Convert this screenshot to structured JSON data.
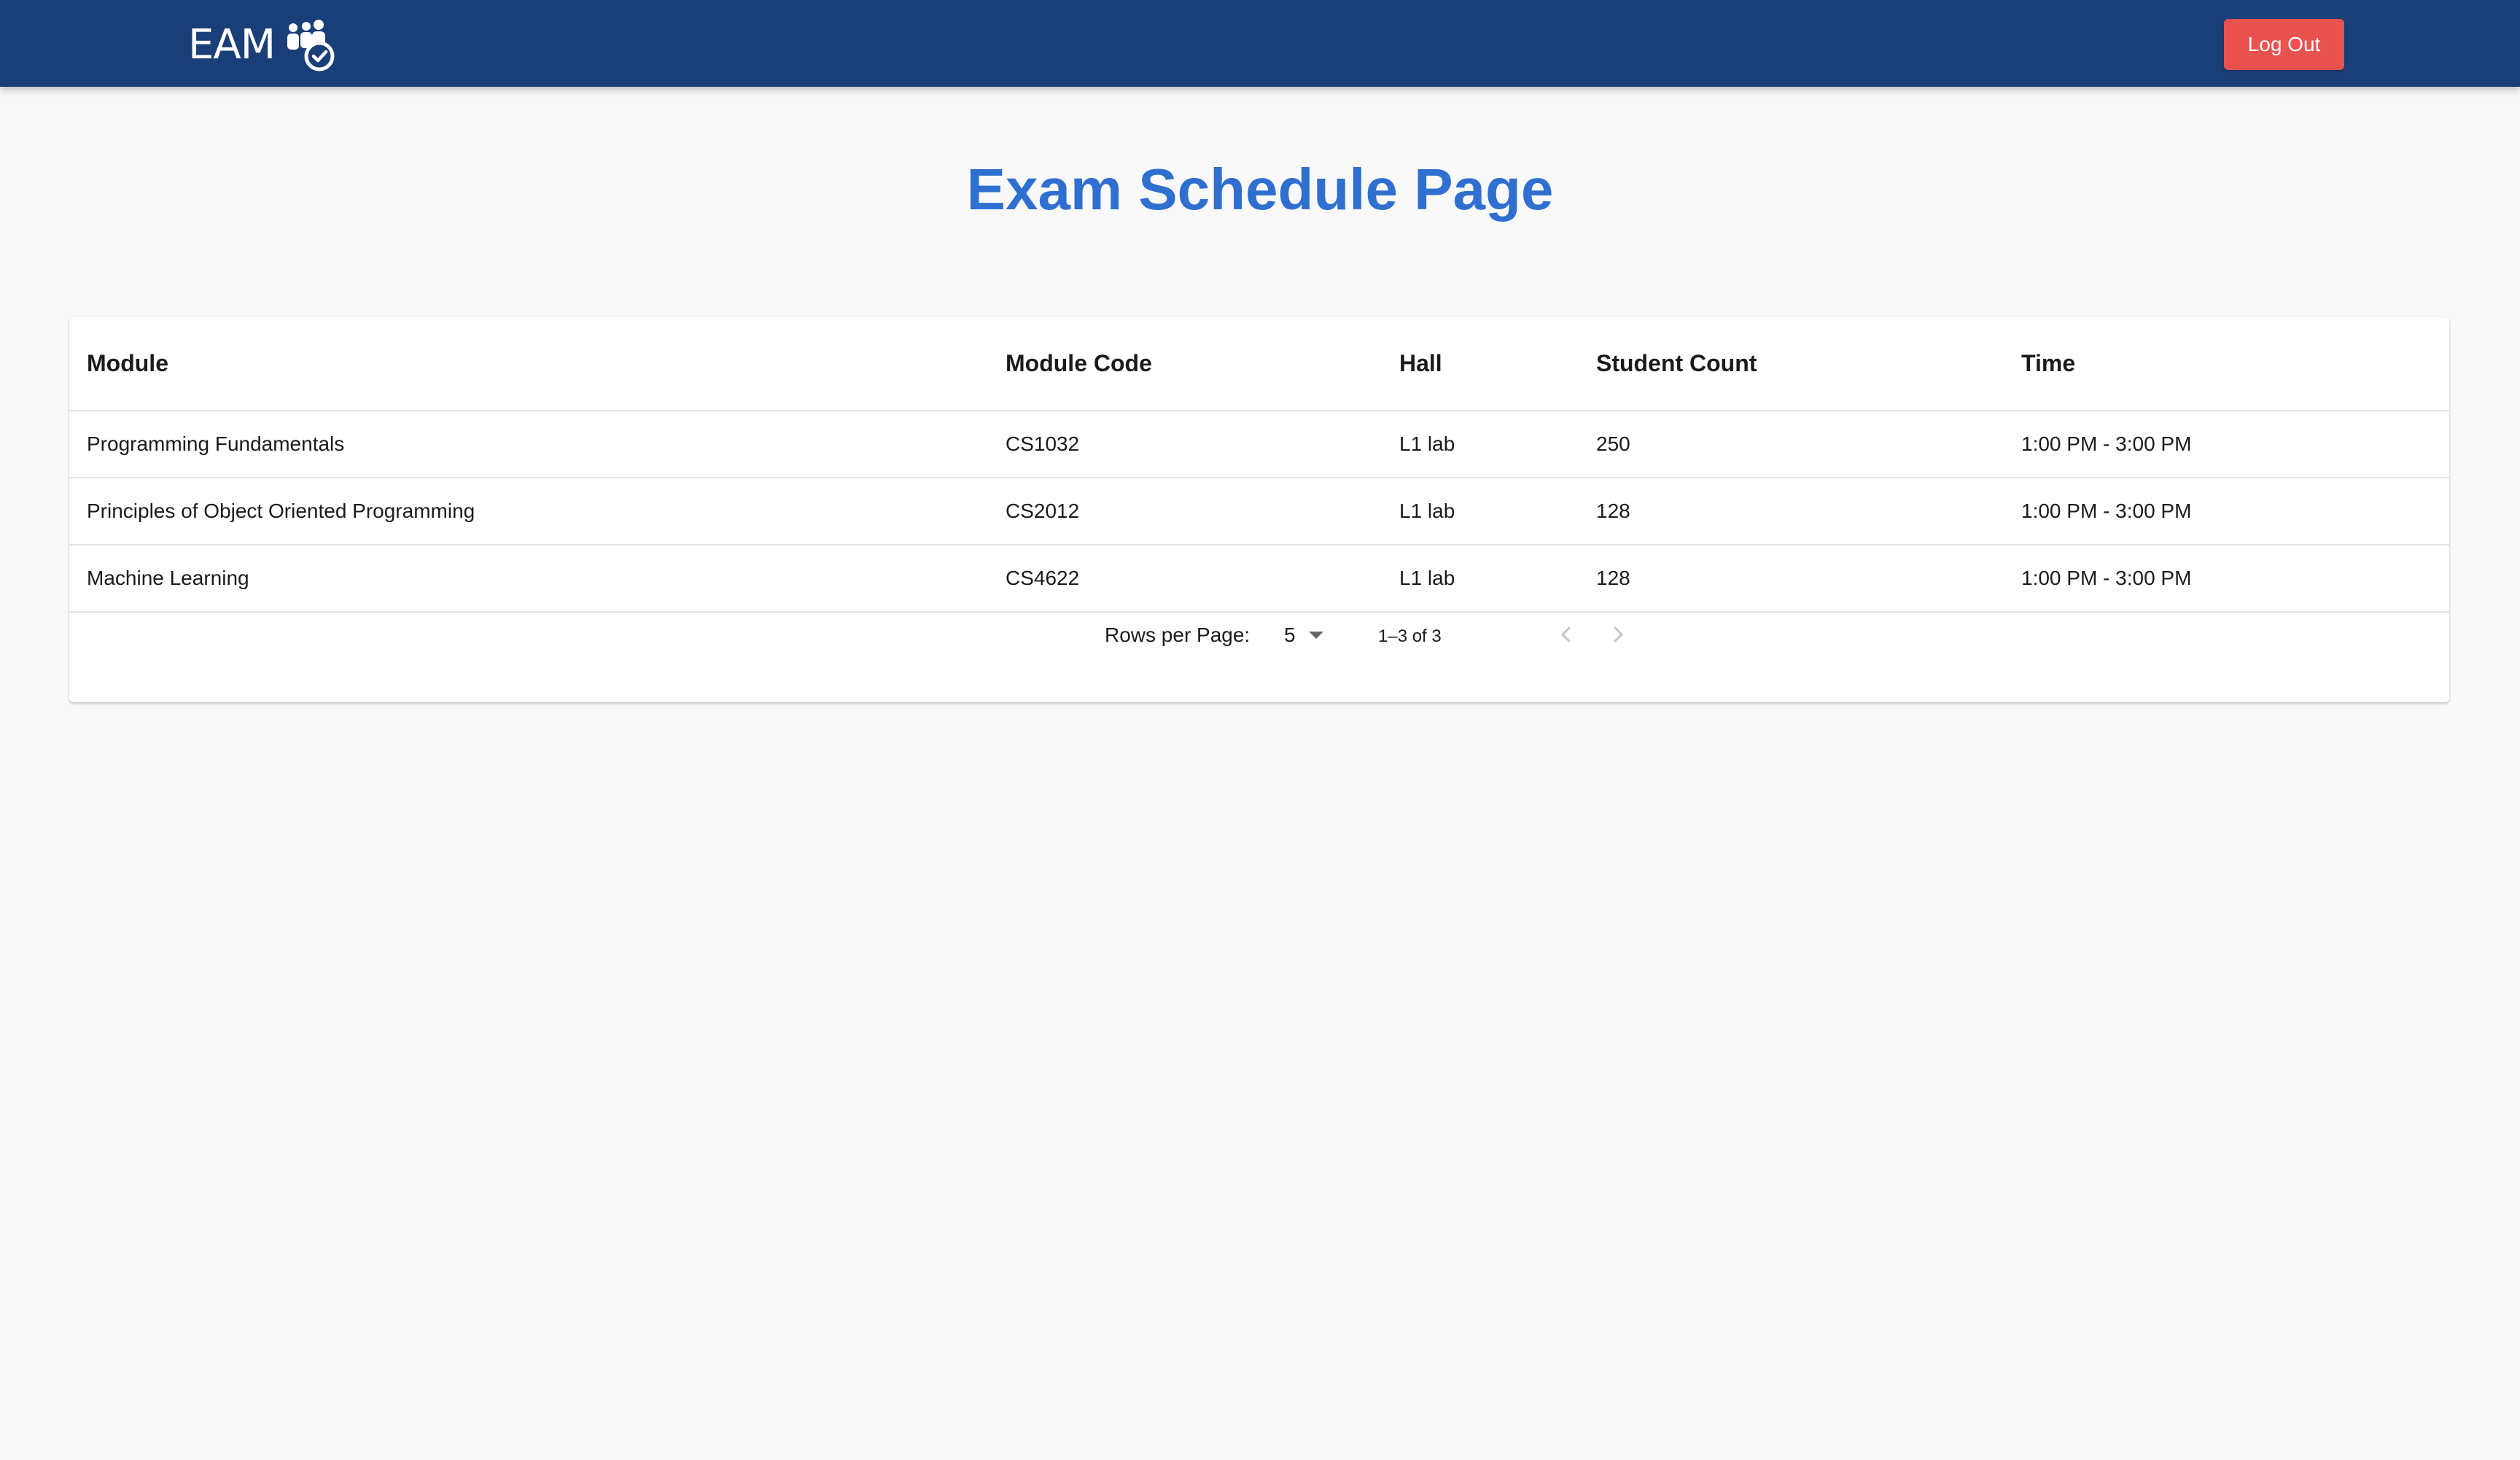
{
  "header": {
    "logo_text": "EAM",
    "logout_label": "Log Out",
    "background_color": "#1a3f78",
    "logout_color": "#e8524f"
  },
  "page": {
    "title": "Exam Schedule Page",
    "title_color": "#2f6fd0"
  },
  "table": {
    "columns": [
      "Module",
      "Module Code",
      "Hall",
      "Student Count",
      "Time"
    ],
    "rows": [
      [
        "Programming Fundamentals",
        "CS1032",
        "L1 lab",
        "250",
        "1:00 PM - 3:00 PM"
      ],
      [
        "Principles of Object Oriented Programming",
        "CS2012",
        "L1 lab",
        "128",
        "1:00 PM - 3:00 PM"
      ],
      [
        "Machine Learning",
        "CS4622",
        "L1 lab",
        "128",
        "1:00 PM - 3:00 PM"
      ]
    ]
  },
  "pagination": {
    "rows_per_page_label": "Rows per Page:",
    "rows_per_page_value": "5",
    "range_text": "1–3 of 3",
    "prev_icon": "chevron-left-icon",
    "next_icon": "chevron-right-icon"
  }
}
